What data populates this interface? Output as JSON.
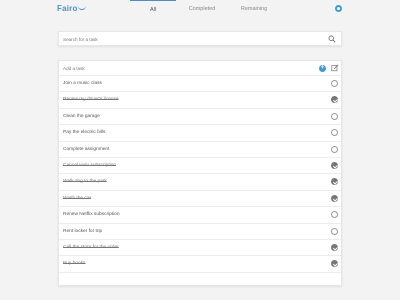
{
  "app": {
    "logo_text": "Fairo"
  },
  "nav": {
    "tabs": [
      {
        "label": "All",
        "active": true
      },
      {
        "label": "Completed",
        "active": false
      },
      {
        "label": "Remaining",
        "active": false
      }
    ]
  },
  "search": {
    "placeholder": "Search for a task"
  },
  "add": {
    "placeholder": "Add a task",
    "add_icon": "plus-icon",
    "edit_icon": "edit-icon"
  },
  "colors": {
    "accent": "#3a9bd5",
    "done": "#777777"
  },
  "tasks": [
    {
      "label": "Join a music class",
      "done": false
    },
    {
      "label": "Renew my driver's license",
      "done": true
    },
    {
      "label": "Clean the garage",
      "done": false
    },
    {
      "label": "Pay the electric bills",
      "done": false
    },
    {
      "label": "Complete assignment",
      "done": false
    },
    {
      "label": "Cancel Hulu subscription",
      "done": true
    },
    {
      "label": "Walk dog to the park",
      "done": true
    },
    {
      "label": "Wash the car",
      "done": true
    },
    {
      "label": "Renew Netflix subscription",
      "done": false
    },
    {
      "label": "Rent locker for trip",
      "done": false
    },
    {
      "label": "Call the store for the order",
      "done": true
    },
    {
      "label": "Buy books",
      "done": true
    }
  ]
}
